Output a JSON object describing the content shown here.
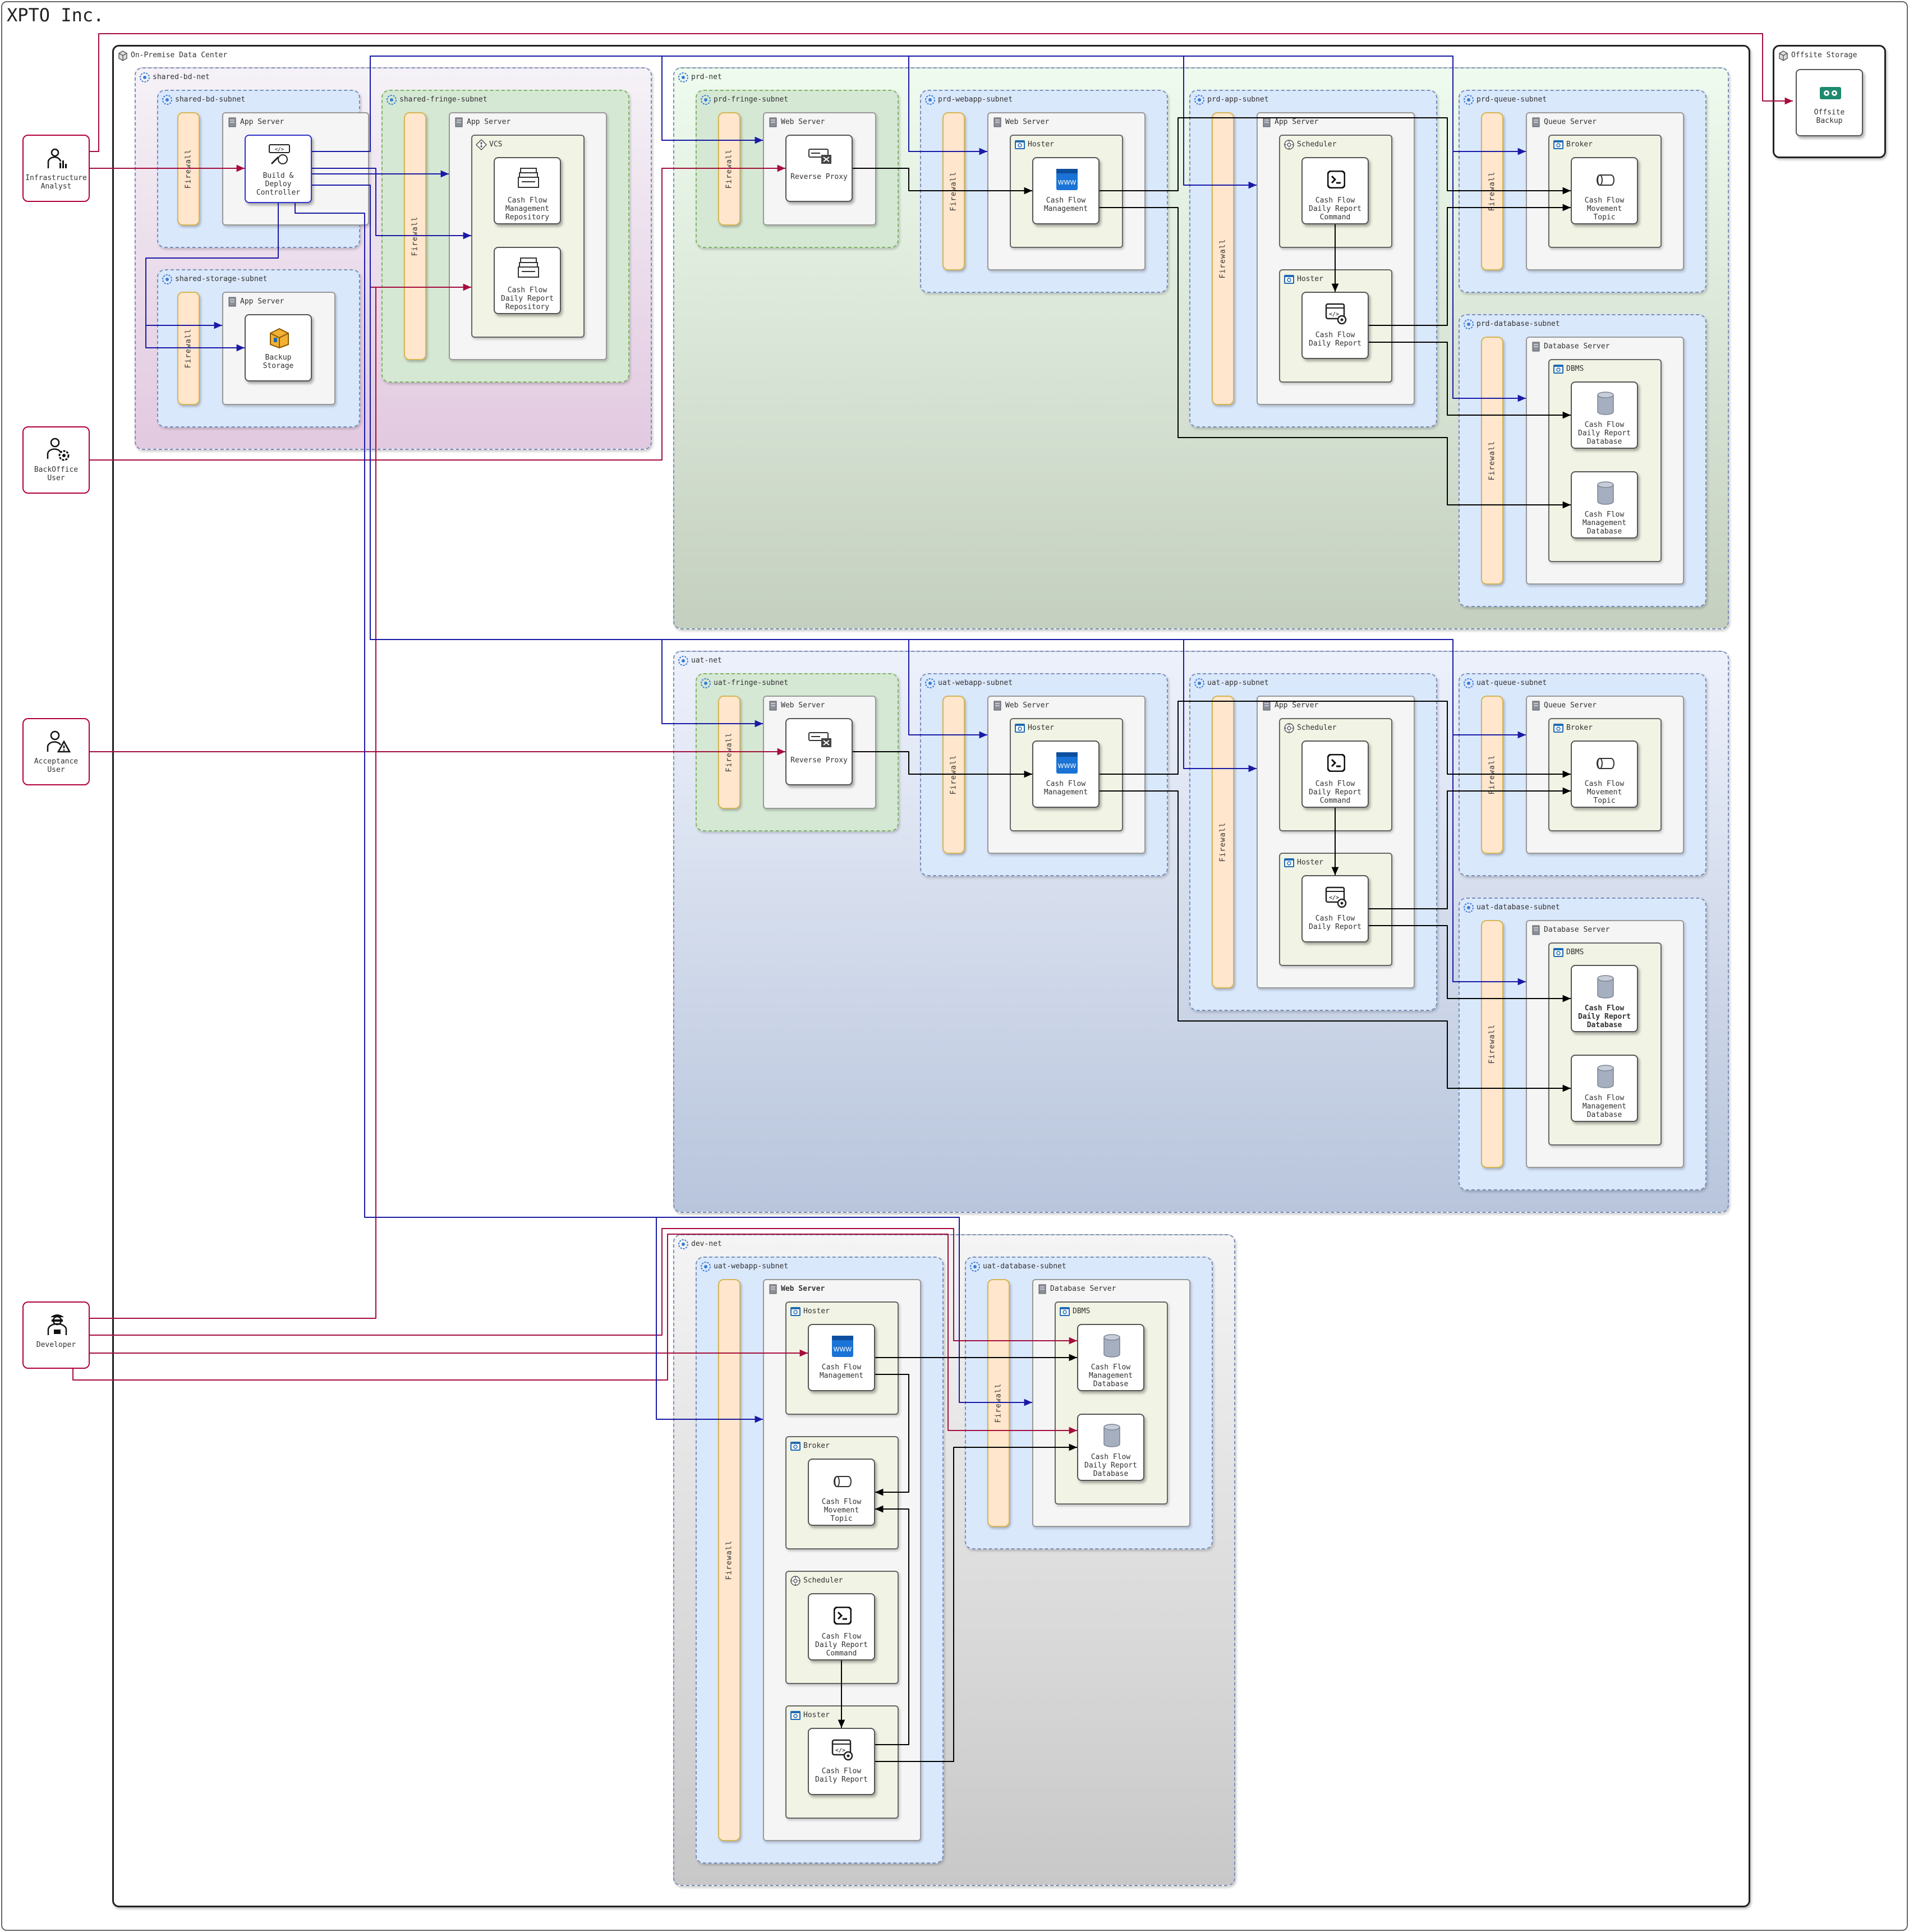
{
  "title": "XPTO Inc.",
  "on_premise_label": "On-Premise Data Center",
  "offsite": {
    "label": "Offsite Storage",
    "backup": "Offsite Backup"
  },
  "actors": {
    "infra": "Infrastructure Analyst",
    "backoffice": "BackOffice User",
    "acceptance": "Acceptance User",
    "developer": "Developer"
  },
  "common": {
    "firewall": "Firewall",
    "app_server": "App Server",
    "web_server": "Web Server",
    "queue_server": "Queue Server",
    "database_server": "Database Server",
    "hoster": "Hoster",
    "scheduler": "Scheduler",
    "broker": "Broker",
    "dbms": "DBMS",
    "vcs": "VCS",
    "reverse_proxy": "Reverse Proxy",
    "cfm": "Cash Flow Management",
    "cfdr": "Cash Flow Daily Report",
    "cfdr_cmd": "Cash Flow Daily Report Command",
    "cfmt": "Cash Flow Movement Topic",
    "cfm_db": "Cash Flow Management Database",
    "cfdr_db": "Cash Flow Daily Report Database",
    "cfm_repo": "Cash Flow Management Repository",
    "cfdr_repo": "Cash Flow Daily Report Repository",
    "build_deploy": "Build & Deploy Controller",
    "backup_storage": "Backup Storage"
  },
  "shared": {
    "net": "shared-bd-net",
    "bd_subnet": "shared-bd-subnet",
    "storage_subnet": "shared-storage-subnet",
    "fringe_subnet": "shared-fringe-subnet"
  },
  "prd": {
    "net": "prd-net",
    "fringe": "prd-fringe-subnet",
    "webapp": "prd-webapp-subnet",
    "app": "prd-app-subnet",
    "queue": "prd-queue-subnet",
    "database": "prd-database-subnet"
  },
  "uat": {
    "net": "uat-net",
    "fringe": "uat-fringe-subnet",
    "webapp": "uat-webapp-subnet",
    "app": "uat-app-subnet",
    "queue": "uat-queue-subnet",
    "database": "uat-database-subnet"
  },
  "dev": {
    "net": "dev-net",
    "webapp": "uat-webapp-subnet",
    "database": "uat-database-subnet"
  },
  "colors": {
    "actor_border": "#b0003a",
    "link_blue": "#1a1aa6",
    "link_red": "#a50d3c",
    "link_black": "#000000",
    "firewall_fill": "#ffe6cc",
    "subnet_fill": "#dae8fc",
    "fringe_fill": "#d5e8d4"
  }
}
